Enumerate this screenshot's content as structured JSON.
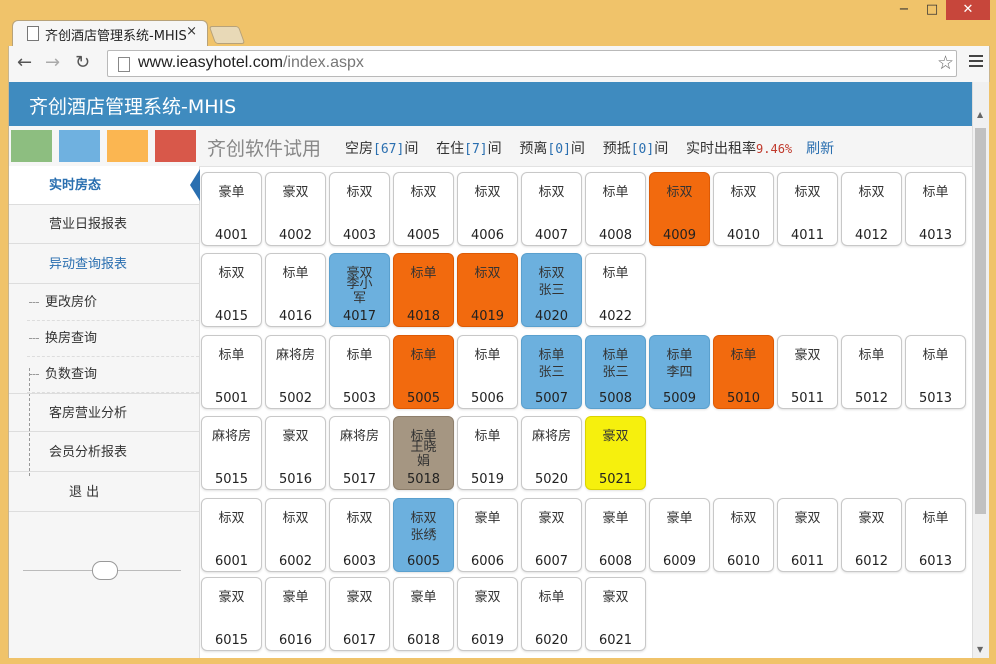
{
  "browser": {
    "tab_title": "齐创酒店管理系统-MHIS",
    "tab_close": "×",
    "url_host": "www.ieasyhotel.com",
    "url_path": "/index.aspx",
    "win_min": "−",
    "win_max": "□",
    "win_close": "✕"
  },
  "app": {
    "title": "齐创酒店管理系统-MHIS",
    "swatch_colors": [
      "#8dbe80",
      "#6fb1e0",
      "#fbb651",
      "#d8584a"
    ]
  },
  "sidebar": {
    "items": [
      {
        "label": "实时房态"
      },
      {
        "label": "营业日报报表"
      },
      {
        "label": "异动查询报表"
      },
      {
        "label": "更改房价"
      },
      {
        "label": "换房查询"
      },
      {
        "label": "负数查询"
      },
      {
        "label": "客房营业分析"
      },
      {
        "label": "会员分析报表"
      },
      {
        "label": "退  出"
      }
    ]
  },
  "topbar": {
    "trial": "齐创软件试用",
    "vacant_label": "空房",
    "vacant_count": "[67]",
    "occupied_label": "在住",
    "occupied_count": "[7]",
    "checkout_label": "预离",
    "checkout_count": "[0]",
    "arrival_label": "预抵",
    "arrival_count": "[0]",
    "unit": "间",
    "rate_label": "实时出租率",
    "rate_value": "9.46%",
    "refresh": "刷新"
  },
  "status_colors": {
    "orange": "#f26a0e",
    "blue": "#6cb0de",
    "gray": "#a59682",
    "yellow": "#f6f00d"
  },
  "rooms": [
    {
      "type": "豪单",
      "num": "4001",
      "status": "",
      "guest": ""
    },
    {
      "type": "豪双",
      "num": "4002",
      "status": "",
      "guest": ""
    },
    {
      "type": "标双",
      "num": "4003",
      "status": "",
      "guest": ""
    },
    {
      "type": "标双",
      "num": "4005",
      "status": "",
      "guest": ""
    },
    {
      "type": "标双",
      "num": "4006",
      "status": "",
      "guest": ""
    },
    {
      "type": "标双",
      "num": "4007",
      "status": "",
      "guest": ""
    },
    {
      "type": "标单",
      "num": "4008",
      "status": "",
      "guest": ""
    },
    {
      "type": "标双",
      "num": "4009",
      "status": "orange",
      "guest": ""
    },
    {
      "type": "标双",
      "num": "4010",
      "status": "",
      "guest": ""
    },
    {
      "type": "标双",
      "num": "4011",
      "status": "",
      "guest": ""
    },
    {
      "type": "标双",
      "num": "4012",
      "status": "",
      "guest": ""
    },
    {
      "type": "标单",
      "num": "4013",
      "status": "",
      "guest": ""
    },
    {
      "type": "标双",
      "num": "4015",
      "status": "",
      "guest": ""
    },
    {
      "type": "标单",
      "num": "4016",
      "status": "",
      "guest": ""
    },
    {
      "type": "豪双",
      "num": "4017",
      "status": "blue",
      "guest": "李小军"
    },
    {
      "type": "标单",
      "num": "4018",
      "status": "orange",
      "guest": ""
    },
    {
      "type": "标双",
      "num": "4019",
      "status": "orange",
      "guest": ""
    },
    {
      "type": "标双",
      "num": "4020",
      "status": "blue",
      "guest": "张三"
    },
    {
      "type": "标单",
      "num": "4022",
      "status": "",
      "guest": ""
    },
    {
      "type": "标单",
      "num": "5001",
      "status": "",
      "guest": ""
    },
    {
      "type": "麻将房",
      "num": "5002",
      "status": "",
      "guest": ""
    },
    {
      "type": "标单",
      "num": "5003",
      "status": "",
      "guest": ""
    },
    {
      "type": "标单",
      "num": "5005",
      "status": "orange",
      "guest": ""
    },
    {
      "type": "标单",
      "num": "5006",
      "status": "",
      "guest": ""
    },
    {
      "type": "标单",
      "num": "5007",
      "status": "blue",
      "guest": "张三"
    },
    {
      "type": "标单",
      "num": "5008",
      "status": "blue",
      "guest": "张三"
    },
    {
      "type": "标单",
      "num": "5009",
      "status": "blue",
      "guest": "李四"
    },
    {
      "type": "标单",
      "num": "5010",
      "status": "orange",
      "guest": ""
    },
    {
      "type": "豪双",
      "num": "5011",
      "status": "",
      "guest": ""
    },
    {
      "type": "标单",
      "num": "5012",
      "status": "",
      "guest": ""
    },
    {
      "type": "标单",
      "num": "5013",
      "status": "",
      "guest": ""
    },
    {
      "type": "麻将房",
      "num": "5015",
      "status": "",
      "guest": ""
    },
    {
      "type": "豪双",
      "num": "5016",
      "status": "",
      "guest": ""
    },
    {
      "type": "麻将房",
      "num": "5017",
      "status": "",
      "guest": ""
    },
    {
      "type": "标单",
      "num": "5018",
      "status": "gray",
      "guest": "王晓娟"
    },
    {
      "type": "标单",
      "num": "5019",
      "status": "",
      "guest": ""
    },
    {
      "type": "麻将房",
      "num": "5020",
      "status": "",
      "guest": ""
    },
    {
      "type": "豪双",
      "num": "5021",
      "status": "yellow",
      "guest": ""
    },
    {
      "type": "标双",
      "num": "6001",
      "status": "",
      "guest": ""
    },
    {
      "type": "标双",
      "num": "6002",
      "status": "",
      "guest": ""
    },
    {
      "type": "标双",
      "num": "6003",
      "status": "",
      "guest": ""
    },
    {
      "type": "标双",
      "num": "6005",
      "status": "blue",
      "guest": "张绣"
    },
    {
      "type": "豪单",
      "num": "6006",
      "status": "",
      "guest": ""
    },
    {
      "type": "豪双",
      "num": "6007",
      "status": "",
      "guest": ""
    },
    {
      "type": "豪单",
      "num": "6008",
      "status": "",
      "guest": ""
    },
    {
      "type": "豪单",
      "num": "6009",
      "status": "",
      "guest": ""
    },
    {
      "type": "标双",
      "num": "6010",
      "status": "",
      "guest": ""
    },
    {
      "type": "豪双",
      "num": "6011",
      "status": "",
      "guest": ""
    },
    {
      "type": "豪双",
      "num": "6012",
      "status": "",
      "guest": ""
    },
    {
      "type": "标单",
      "num": "6013",
      "status": "",
      "guest": ""
    },
    {
      "type": "豪双",
      "num": "6015",
      "status": "",
      "guest": ""
    },
    {
      "type": "豪单",
      "num": "6016",
      "status": "",
      "guest": ""
    },
    {
      "type": "豪双",
      "num": "6017",
      "status": "",
      "guest": ""
    },
    {
      "type": "豪单",
      "num": "6018",
      "status": "",
      "guest": ""
    },
    {
      "type": "豪双",
      "num": "6019",
      "status": "",
      "guest": ""
    },
    {
      "type": "标单",
      "num": "6020",
      "status": "",
      "guest": ""
    },
    {
      "type": "豪双",
      "num": "6021",
      "status": "",
      "guest": ""
    }
  ]
}
